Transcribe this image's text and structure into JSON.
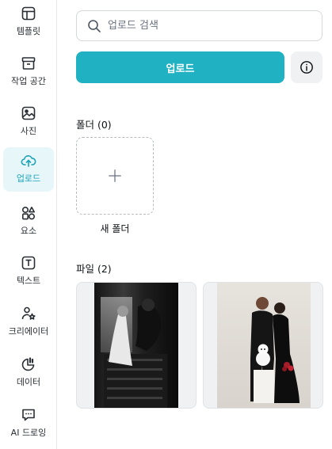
{
  "sidebar": {
    "items": [
      {
        "label": "템플릿",
        "icon": "template-icon",
        "active": false
      },
      {
        "label": "작업 공간",
        "icon": "archive-box-icon",
        "active": false
      },
      {
        "label": "사진",
        "icon": "image-icon",
        "active": false
      },
      {
        "label": "업로드",
        "icon": "cloud-upload-icon",
        "active": true
      },
      {
        "label": "요소",
        "icon": "elements-shapes-icon",
        "active": false
      },
      {
        "label": "텍스트",
        "icon": "text-box-icon",
        "active": false
      },
      {
        "label": "크리에이터",
        "icon": "creator-star-icon",
        "active": false
      },
      {
        "label": "데이터",
        "icon": "chart-data-icon",
        "active": false
      },
      {
        "label": "AI 드로잉",
        "icon": "ai-chat-icon",
        "active": false
      }
    ]
  },
  "search": {
    "placeholder": "업로드 검색",
    "value": ""
  },
  "toolbar": {
    "upload_label": "업로드",
    "info_icon": "info-icon"
  },
  "folders": {
    "title": "폴더 (0)",
    "new_folder_label": "새 폴더",
    "plus_icon": "plus-icon"
  },
  "files": {
    "title": "파일 (2)",
    "items": [
      {
        "type": "image",
        "style": "black-and-white wedding photo"
      },
      {
        "type": "image",
        "style": "color studio couple photo with dog"
      }
    ]
  },
  "colors": {
    "accent": "#20b2c3",
    "active_bg": "#e7f6f9",
    "active_text": "#1da3b8"
  }
}
